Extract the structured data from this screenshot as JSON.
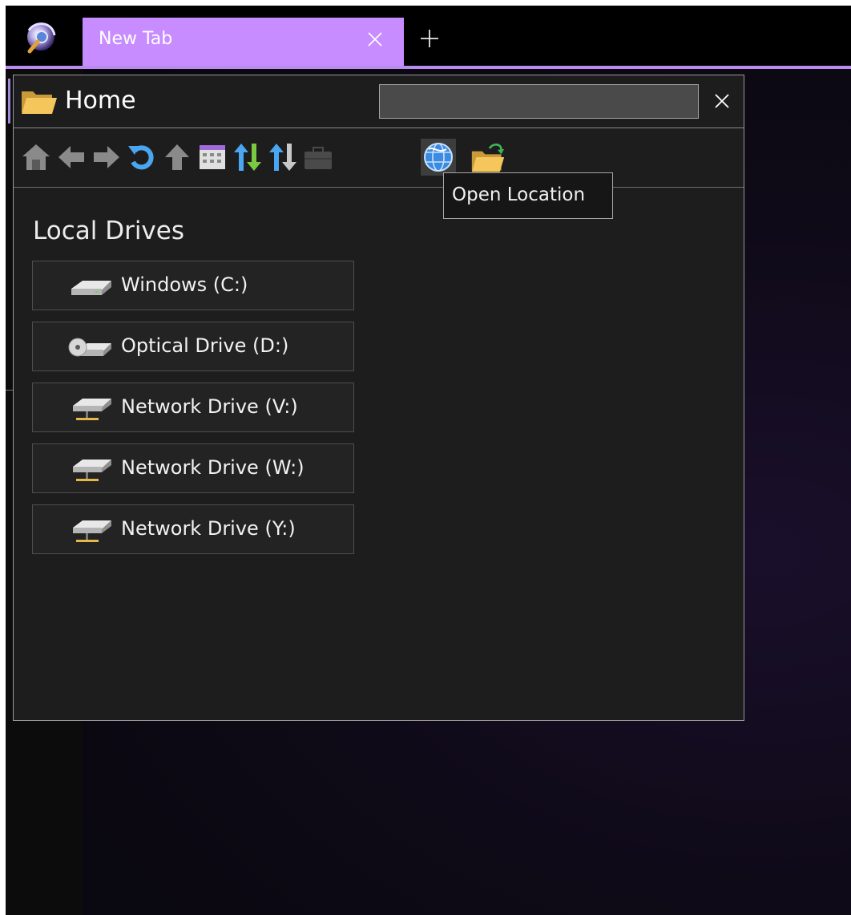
{
  "tab": {
    "title": "New Tab"
  },
  "panel": {
    "title": "Home",
    "search": {
      "value": "",
      "placeholder": ""
    },
    "tooltip": "Open Location",
    "toolbar": [
      "home",
      "back",
      "forward",
      "refresh",
      "up",
      "view",
      "sort-ascending",
      "sort-descending",
      "briefcase",
      "open-location",
      "open-folder"
    ]
  },
  "drives": {
    "section_title": "Local Drives",
    "items": [
      {
        "label": "Windows (C:)",
        "icon": "hard-drive-icon"
      },
      {
        "label": "Optical Drive (D:)",
        "icon": "optical-drive-icon"
      },
      {
        "label": "Network Drive (V:)",
        "icon": "network-drive-icon"
      },
      {
        "label": "Network Drive (W:)",
        "icon": "network-drive-icon"
      },
      {
        "label": "Network Drive (Y:)",
        "icon": "network-drive-icon"
      }
    ]
  },
  "colors": {
    "accent": "#c78cff",
    "accent_line": "#b98af0",
    "panel_bg": "#1d1d1d",
    "toolbar_blue": "#4aa6f0",
    "toolbar_green": "#79c943"
  }
}
